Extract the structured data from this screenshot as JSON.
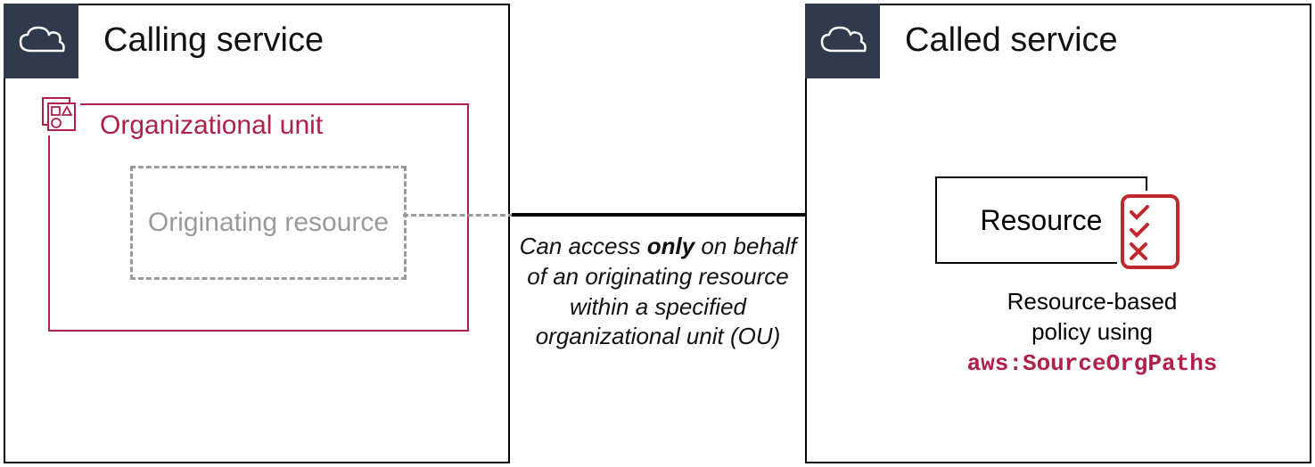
{
  "left_panel": {
    "title": "Calling service",
    "ou_label": "Organizational unit",
    "origin_label": "Originating resource"
  },
  "right_panel": {
    "title": "Called service",
    "resource_label": "Resource",
    "policy_line1": "Resource-based",
    "policy_line2": "policy using",
    "policy_code": "aws:SourceOrgPaths"
  },
  "caption": {
    "pre": "Can access ",
    "bold": "only",
    "post": " on behalf of an originating resource within a specified organizational unit (OU)"
  }
}
